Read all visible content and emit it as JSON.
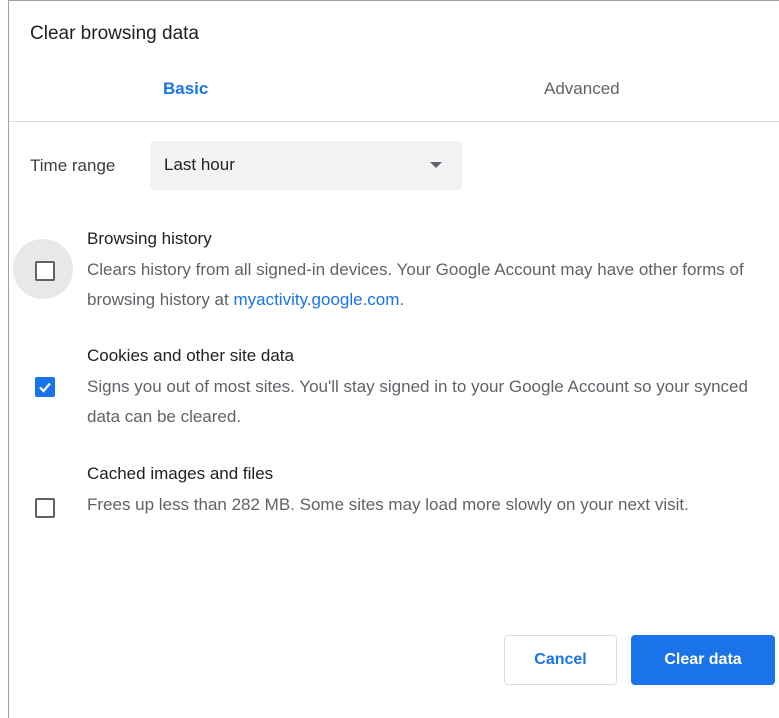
{
  "dialog": {
    "title": "Clear browsing data"
  },
  "tabs": {
    "basic": "Basic",
    "advanced": "Advanced",
    "active": "basic",
    "accent_color": "#1a73e8"
  },
  "time_range": {
    "label": "Time range",
    "selected": "Last hour"
  },
  "options": [
    {
      "title": "Browsing history",
      "desc_before_link": "Clears history from all signed-in devices. Your Google Account may have other forms of browsing history at ",
      "link": "myactivity.google.com",
      "desc_after_link": ".",
      "checked": false
    },
    {
      "title": "Cookies and other site data",
      "desc": "Signs you out of most sites. You'll stay signed in to your Google Account so your synced data can be cleared.",
      "checked": true
    },
    {
      "title": "Cached images and files",
      "desc": "Frees up less than 282 MB. Some sites may load more slowly on your next visit.",
      "checked": false
    }
  ],
  "buttons": {
    "cancel": "Cancel",
    "clear": "Clear data"
  }
}
